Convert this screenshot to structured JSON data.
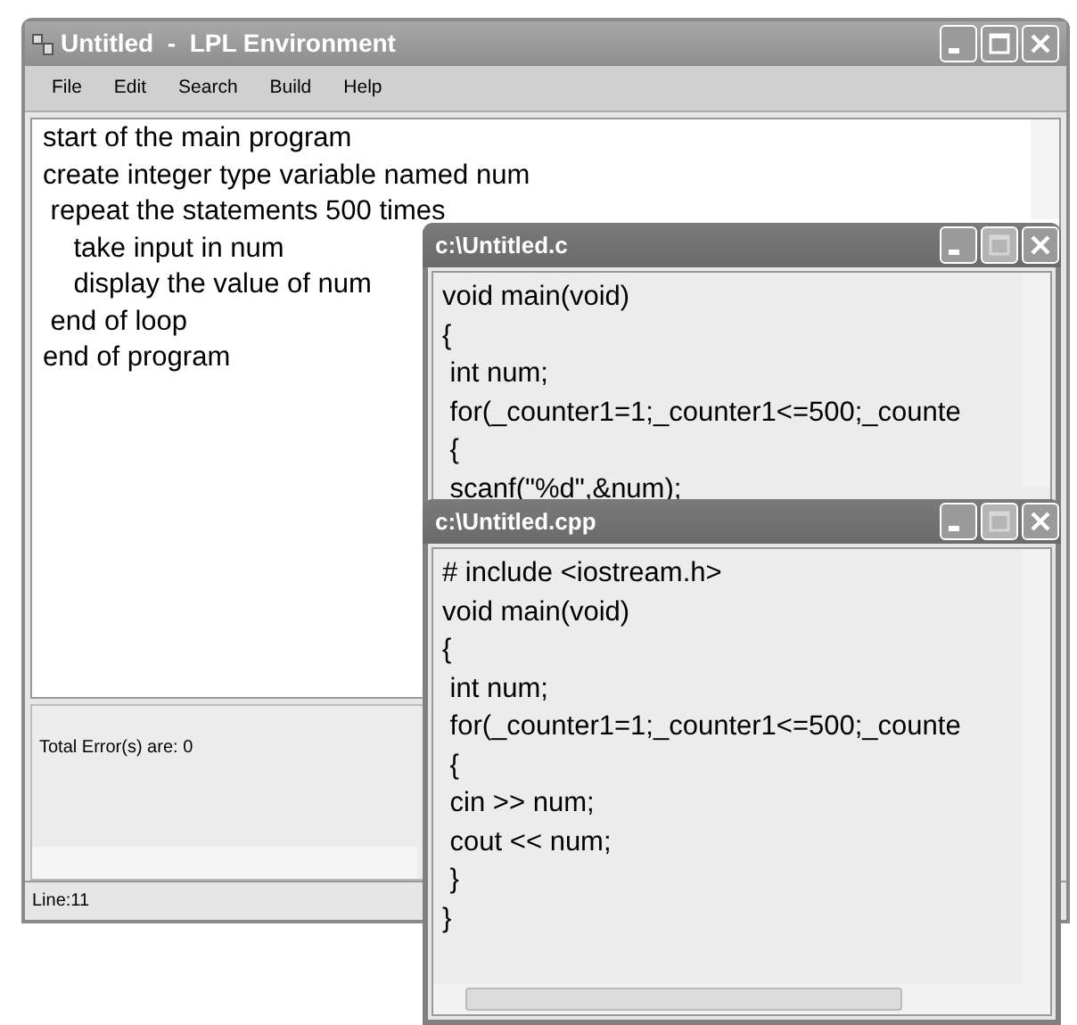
{
  "main_window": {
    "title": "Untitled  -  LPL Environment",
    "menu": [
      "File",
      "Edit",
      "Search",
      "Build",
      "Help"
    ],
    "editor_lines": [
      "start of the main program",
      "create integer type variable named num",
      " repeat the statements 500 times",
      "    take input in num",
      "    display the value of num",
      " end of loop",
      "end of program"
    ],
    "output": "Total Error(s) are: 0",
    "status_bar": "Line:11"
  },
  "child_windows": [
    {
      "title": "c:\\Untitled.c",
      "maximize_disabled": true,
      "lines": [
        "void main(void)",
        "{",
        " int num;",
        " for(_counter1=1;_counter1<=500;_counte",
        " {",
        " scanf(\"%d\",&num);"
      ]
    },
    {
      "title": "c:\\Untitled.cpp",
      "maximize_disabled": true,
      "lines": [
        "# include <iostream.h>",
        "void main(void)",
        "{",
        " int num;",
        " for(_counter1=1;_counter1<=500;_counte",
        " {",
        " cin >> num;",
        " cout << num;",
        " }",
        "}"
      ]
    }
  ]
}
